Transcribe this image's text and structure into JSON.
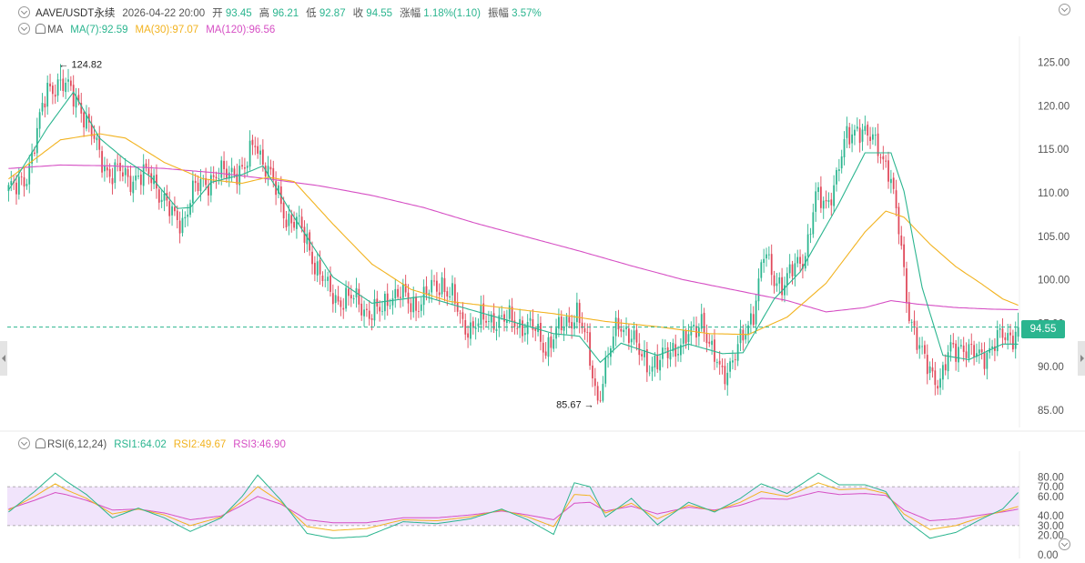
{
  "header": {
    "symbol": "AAVE/USDT永续",
    "datetime": "2026-04-22 20:00",
    "open_label": "开",
    "open": "93.45",
    "high_label": "高",
    "high": "96.21",
    "low_label": "低",
    "low": "92.87",
    "close_label": "收",
    "close": "94.55",
    "change_label": "涨幅",
    "change": "1.18%(1.10)",
    "amplitude_label": "振幅",
    "amplitude": "3.57%"
  },
  "ma_header": {
    "name": "MA",
    "ma7": "MA(7):92.59",
    "ma30": "MA(30):97.07",
    "ma120": "MA(120):96.56"
  },
  "rsi_header": {
    "name": "RSI(6,12,24)",
    "rsi1": "RSI1:64.02",
    "rsi2": "RSI2:49.67",
    "rsi3": "RSI3:46.90"
  },
  "colors": {
    "up": "#2bb58f",
    "down": "#e0495a",
    "ma7": "#2bb58f",
    "ma30": "#f2b320",
    "ma120": "#d64fc4",
    "rsi1": "#2bb58f",
    "rsi2": "#f2b320",
    "rsi3": "#d64fc4",
    "rsi_band": "#f1e4fb"
  },
  "price_tag": "94.55",
  "chart_data": [
    {
      "type": "candlestick",
      "ylim": [
        83,
        128
      ],
      "y_ticks": [
        "125.00",
        "120.00",
        "115.00",
        "110.00",
        "105.00",
        "100.00",
        "95.00",
        "90.00",
        "85.00"
      ],
      "y_tick_values": [
        125,
        120,
        115,
        110,
        105,
        100,
        95,
        90,
        85
      ],
      "current_price": 94.55,
      "annotations": {
        "high": "← 124.82",
        "low": "85.67 →"
      },
      "high_value": 124.82,
      "low_value": 85.67,
      "close_anchors": [
        [
          0,
          110.5
        ],
        [
          3,
          110.3
        ],
        [
          7,
          112.2
        ],
        [
          11,
          116.8
        ],
        [
          15,
          122
        ],
        [
          19,
          122.7
        ],
        [
          23,
          121.8
        ],
        [
          27,
          120.7
        ],
        [
          31,
          117.2
        ],
        [
          35,
          114.6
        ],
        [
          39,
          112.1
        ],
        [
          43,
          112.3
        ],
        [
          47,
          111.8
        ],
        [
          51,
          111.7
        ],
        [
          55,
          112.1
        ],
        [
          59,
          109.7
        ],
        [
          63,
          107.2
        ],
        [
          67,
          106.8
        ],
        [
          71,
          110
        ],
        [
          75,
          111.2
        ],
        [
          79,
          111.9
        ],
        [
          83,
          112
        ],
        [
          87,
          112.8
        ],
        [
          91,
          112.5
        ],
        [
          95,
          116
        ],
        [
          99,
          113.2
        ],
        [
          103,
          110.2
        ],
        [
          107,
          107.3
        ],
        [
          111,
          106.5
        ],
        [
          115,
          104.5
        ],
        [
          119,
          101.2
        ],
        [
          123,
          98.8
        ],
        [
          127,
          97.8
        ],
        [
          131,
          97.7
        ],
        [
          135,
          97.6
        ],
        [
          139,
          96.1
        ],
        [
          143,
          96.2
        ],
        [
          147,
          98.4
        ],
        [
          151,
          98.2
        ],
        [
          155,
          97.2
        ],
        [
          159,
          97.6
        ],
        [
          163,
          98.8
        ],
        [
          167,
          99.8
        ],
        [
          171,
          97.8
        ],
        [
          175,
          94.9
        ],
        [
          179,
          94.6
        ],
        [
          183,
          95.3
        ],
        [
          187,
          95.6
        ],
        [
          191,
          95.2
        ],
        [
          195,
          95.3
        ],
        [
          199,
          94.6
        ],
        [
          203,
          94.1
        ],
        [
          207,
          92.3
        ],
        [
          211,
          93.7
        ],
        [
          215,
          95.2
        ],
        [
          219,
          96.3
        ],
        [
          223,
          92.3
        ],
        [
          227,
          86.3
        ],
        [
          231,
          90.8
        ],
        [
          235,
          95.4
        ],
        [
          239,
          93.8
        ],
        [
          243,
          91.5
        ],
        [
          247,
          90.4
        ],
        [
          251,
          90.4
        ],
        [
          255,
          92.1
        ],
        [
          259,
          92.6
        ],
        [
          263,
          93.5
        ],
        [
          267,
          95.8
        ],
        [
          271,
          91.2
        ],
        [
          275,
          89.4
        ],
        [
          279,
          90.7
        ],
        [
          283,
          93.2
        ],
        [
          287,
          96.6
        ],
        [
          291,
          102.8
        ],
        [
          295,
          100.2
        ],
        [
          299,
          99.6
        ],
        [
          303,
          101.3
        ],
        [
          307,
          103.2
        ],
        [
          311,
          109.2
        ],
        [
          315,
          108.8
        ],
        [
          319,
          111.8
        ],
        [
          323,
          116.3
        ],
        [
          327,
          117.8
        ],
        [
          331,
          116.2
        ],
        [
          335,
          115.6
        ],
        [
          339,
          112.6
        ],
        [
          343,
          105.8
        ],
        [
          347,
          96.3
        ],
        [
          351,
          91.6
        ],
        [
          355,
          89.9
        ],
        [
          359,
          88.1
        ],
        [
          363,
          91.9
        ],
        [
          367,
          92.6
        ],
        [
          371,
          91.2
        ],
        [
          375,
          91.5
        ],
        [
          379,
          92.2
        ],
        [
          383,
          93.5
        ],
        [
          387,
          93.8
        ],
        [
          389,
          94.55
        ]
      ],
      "ma7": [
        [
          0,
          110.3
        ],
        [
          15,
          117.5
        ],
        [
          25,
          121.6
        ],
        [
          35,
          116.3
        ],
        [
          45,
          113.8
        ],
        [
          55,
          111.8
        ],
        [
          65,
          108.2
        ],
        [
          70,
          108.3
        ],
        [
          78,
          111.2
        ],
        [
          90,
          112.1
        ],
        [
          98,
          113.1
        ],
        [
          110,
          107.2
        ],
        [
          125,
          100.3
        ],
        [
          140,
          97.3
        ],
        [
          160,
          98.1
        ],
        [
          175,
          96.8
        ],
        [
          195,
          95.1
        ],
        [
          210,
          93.8
        ],
        [
          220,
          93.5
        ],
        [
          228,
          90.5
        ],
        [
          236,
          92.7
        ],
        [
          250,
          91.3
        ],
        [
          262,
          92.6
        ],
        [
          275,
          91.5
        ],
        [
          283,
          91.6
        ],
        [
          295,
          97.8
        ],
        [
          305,
          100.9
        ],
        [
          320,
          108.8
        ],
        [
          330,
          114.6
        ],
        [
          340,
          114.6
        ],
        [
          345,
          110.2
        ],
        [
          352,
          99.1
        ],
        [
          360,
          91.3
        ],
        [
          370,
          90.8
        ],
        [
          383,
          92.6
        ],
        [
          389,
          92.59
        ]
      ],
      "ma30": [
        [
          0,
          111.6
        ],
        [
          20,
          116.1
        ],
        [
          35,
          116.8
        ],
        [
          45,
          116.3
        ],
        [
          60,
          113.5
        ],
        [
          75,
          111.6
        ],
        [
          90,
          111.1
        ],
        [
          100,
          111.8
        ],
        [
          110,
          111.3
        ],
        [
          125,
          106.4
        ],
        [
          140,
          101.8
        ],
        [
          155,
          98.9
        ],
        [
          170,
          97.5
        ],
        [
          190,
          96.8
        ],
        [
          210,
          96.1
        ],
        [
          230,
          95.2
        ],
        [
          250,
          94.6
        ],
        [
          270,
          93.8
        ],
        [
          285,
          93.7
        ],
        [
          300,
          95.7
        ],
        [
          315,
          99.6
        ],
        [
          330,
          105.5
        ],
        [
          338,
          107.9
        ],
        [
          345,
          107.2
        ],
        [
          355,
          104.1
        ],
        [
          365,
          101.5
        ],
        [
          375,
          99.5
        ],
        [
          383,
          97.8
        ],
        [
          389,
          97.07
        ]
      ],
      "ma120": [
        [
          0,
          112.8
        ],
        [
          20,
          113.2
        ],
        [
          40,
          113.1
        ],
        [
          60,
          112.8
        ],
        [
          80,
          112.3
        ],
        [
          100,
          111.6
        ],
        [
          120,
          110.8
        ],
        [
          140,
          109.7
        ],
        [
          160,
          108.3
        ],
        [
          180,
          106.5
        ],
        [
          200,
          104.9
        ],
        [
          220,
          103.3
        ],
        [
          240,
          101.6
        ],
        [
          260,
          100
        ],
        [
          280,
          98.8
        ],
        [
          300,
          97.6
        ],
        [
          315,
          96.3
        ],
        [
          330,
          96.8
        ],
        [
          340,
          97.6
        ],
        [
          350,
          97.2
        ],
        [
          365,
          96.8
        ],
        [
          380,
          96.6
        ],
        [
          389,
          96.56
        ]
      ]
    },
    {
      "type": "line",
      "ylim": [
        0,
        100
      ],
      "band": [
        30,
        70
      ],
      "y_ticks": [
        "80.00",
        "70.00",
        "60.00",
        "40.00",
        "30.00",
        "20.00",
        "0.00"
      ],
      "y_tick_values": [
        80,
        70,
        60,
        40,
        30,
        20,
        0
      ],
      "series": [
        {
          "name": "RSI1",
          "values": [
            [
              0,
              44
            ],
            [
              10,
              65
            ],
            [
              18,
              84
            ],
            [
              22,
              76
            ],
            [
              30,
              62
            ],
            [
              40,
              38
            ],
            [
              50,
              48
            ],
            [
              60,
              38
            ],
            [
              70,
              24
            ],
            [
              82,
              38
            ],
            [
              90,
              60
            ],
            [
              96,
              82
            ],
            [
              105,
              56
            ],
            [
              115,
              22
            ],
            [
              125,
              17
            ],
            [
              138,
              19
            ],
            [
              152,
              34
            ],
            [
              165,
              32
            ],
            [
              178,
              37
            ],
            [
              190,
              47
            ],
            [
              200,
              36
            ],
            [
              210,
              21
            ],
            [
              218,
              74
            ],
            [
              224,
              70
            ],
            [
              230,
              39
            ],
            [
              240,
              58
            ],
            [
              250,
              31
            ],
            [
              262,
              54
            ],
            [
              272,
              44
            ],
            [
              282,
              58
            ],
            [
              290,
              73
            ],
            [
              300,
              63
            ],
            [
              312,
              84
            ],
            [
              320,
              72
            ],
            [
              330,
              72
            ],
            [
              338,
              65
            ],
            [
              345,
              37
            ],
            [
              355,
              17
            ],
            [
              365,
              23
            ],
            [
              375,
              37
            ],
            [
              383,
              47
            ],
            [
              389,
              64.02
            ]
          ]
        },
        {
          "name": "RSI2",
          "values": [
            [
              0,
              46
            ],
            [
              10,
              60
            ],
            [
              18,
              73
            ],
            [
              22,
              67
            ],
            [
              30,
              58
            ],
            [
              40,
              42
            ],
            [
              50,
              47
            ],
            [
              60,
              41
            ],
            [
              70,
              30
            ],
            [
              82,
              39
            ],
            [
              90,
              55
            ],
            [
              96,
              70
            ],
            [
              105,
              54
            ],
            [
              115,
              29
            ],
            [
              125,
              25
            ],
            [
              138,
              27
            ],
            [
              152,
              36
            ],
            [
              165,
              35
            ],
            [
              178,
              39
            ],
            [
              190,
              46
            ],
            [
              200,
              39
            ],
            [
              210,
              29
            ],
            [
              218,
              62
            ],
            [
              224,
              61
            ],
            [
              230,
              43
            ],
            [
              240,
              53
            ],
            [
              250,
              37
            ],
            [
              262,
              51
            ],
            [
              272,
              45
            ],
            [
              282,
              54
            ],
            [
              290,
              65
            ],
            [
              300,
              60
            ],
            [
              312,
              74
            ],
            [
              320,
              67
            ],
            [
              330,
              68
            ],
            [
              338,
              63
            ],
            [
              345,
              42
            ],
            [
              355,
              26
            ],
            [
              365,
              30
            ],
            [
              375,
              39
            ],
            [
              383,
              45
            ],
            [
              389,
              49.67
            ]
          ]
        },
        {
          "name": "RSI3",
          "values": [
            [
              0,
              47
            ],
            [
              10,
              56
            ],
            [
              18,
              64
            ],
            [
              22,
              62
            ],
            [
              30,
              56
            ],
            [
              40,
              46
            ],
            [
              50,
              47
            ],
            [
              60,
              43
            ],
            [
              70,
              36
            ],
            [
              82,
              40
            ],
            [
              90,
              51
            ],
            [
              96,
              60
            ],
            [
              105,
              52
            ],
            [
              115,
              36
            ],
            [
              125,
              33
            ],
            [
              138,
              33
            ],
            [
              152,
              38
            ],
            [
              165,
              38
            ],
            [
              178,
              41
            ],
            [
              190,
              45
            ],
            [
              200,
              41
            ],
            [
              210,
              36
            ],
            [
              218,
              53
            ],
            [
              224,
              54
            ],
            [
              230,
              45
            ],
            [
              240,
              50
            ],
            [
              250,
              42
            ],
            [
              262,
              49
            ],
            [
              272,
              46
            ],
            [
              282,
              51
            ],
            [
              290,
              58
            ],
            [
              300,
              57
            ],
            [
              312,
              65
            ],
            [
              320,
              62
            ],
            [
              330,
              63
            ],
            [
              338,
              61
            ],
            [
              345,
              46
            ],
            [
              355,
              35
            ],
            [
              365,
              37
            ],
            [
              375,
              41
            ],
            [
              383,
              44
            ],
            [
              389,
              46.9
            ]
          ]
        }
      ]
    }
  ]
}
